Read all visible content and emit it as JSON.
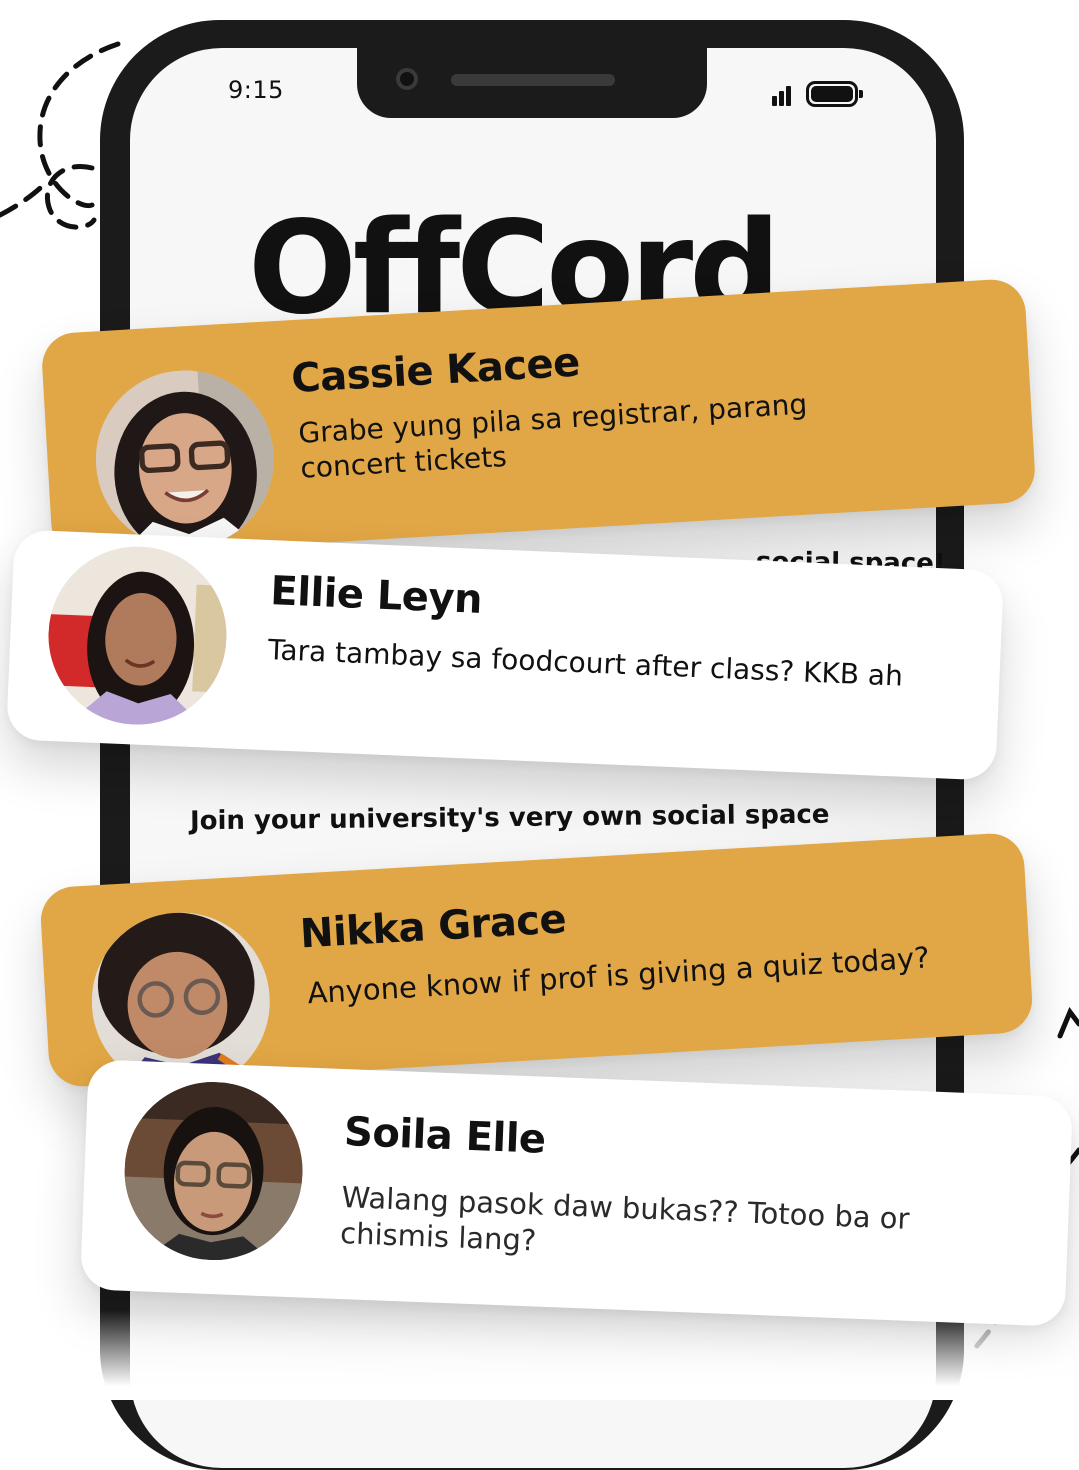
{
  "status_bar": {
    "time": "9:15"
  },
  "app": {
    "title": "OffCord"
  },
  "peek": {
    "line_1": "social space!",
    "line_2": "Join your university's very own social space"
  },
  "cards": [
    {
      "name": "Cassie Kacee",
      "message": "Grabe yung pila sa registrar, parang concert tickets",
      "color": "#e1a645"
    },
    {
      "name": "Ellie Leyn",
      "message": "Tara tambay sa foodcourt after class? KKB ah",
      "color": "#ffffff"
    },
    {
      "name": "Nikka Grace",
      "message": "Anyone know if prof is giving a quiz today?",
      "color": "#e1a645"
    },
    {
      "name": "Soila Elle",
      "message": "Walang pasok daw bukas?? Totoo ba or chismis lang?",
      "color": "#ffffff"
    }
  ],
  "icons": [
    "signal-icon",
    "battery-icon"
  ],
  "colors": {
    "accent": "#e1a645",
    "phone_frame": "#1b1b1b",
    "screen": "#f7f7f7"
  }
}
